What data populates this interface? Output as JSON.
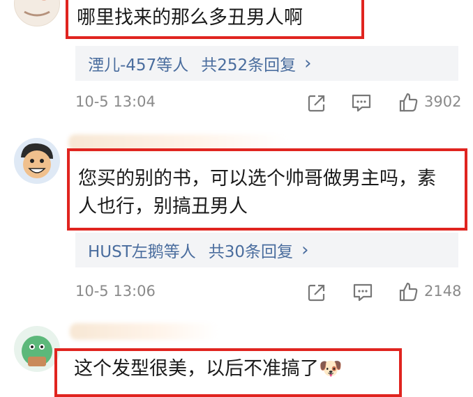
{
  "comments": [
    {
      "text": "哪里找来的那么多丑男人啊",
      "reply_users": "湮儿-457等人",
      "reply_count": "共252条回复",
      "reply_chevron": "›",
      "time": "10-5 13:04",
      "likes": "3902"
    },
    {
      "text": "您买的别的书，可以选个帅哥做男主吗，素人也行，别搞丑男人",
      "reply_users": "HUST左鹅等人",
      "reply_count": "共30条回复",
      "reply_chevron": "›",
      "time": "10-5 13:06",
      "likes": "2148"
    },
    {
      "text": "这个发型很美，以后不准搞了🐶",
      "reply_users": "",
      "reply_count": "",
      "time": "",
      "likes": ""
    }
  ],
  "colors": {
    "highlight": "#e0241f",
    "link": "#4a6d9e",
    "reply_bg": "#f3f4f6",
    "meta": "#8a8a8a"
  },
  "icons": [
    "share-icon",
    "comment-icon",
    "thumbs-up-icon"
  ]
}
